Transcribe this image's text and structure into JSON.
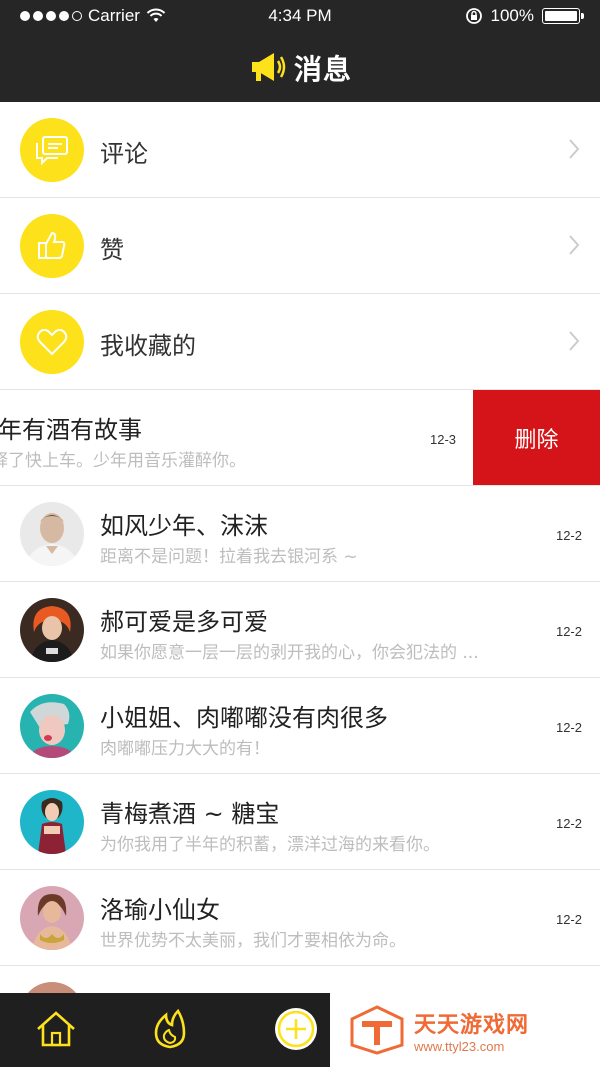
{
  "status_bar": {
    "carrier": "Carrier",
    "time": "4:34 PM",
    "battery": "100%"
  },
  "header": {
    "title": "消息",
    "icon": "megaphone-icon"
  },
  "menu": [
    {
      "label": "评论",
      "icon": "comment-icon"
    },
    {
      "label": "赞",
      "icon": "thumbs-up-icon"
    },
    {
      "label": "我收藏的",
      "icon": "heart-icon"
    }
  ],
  "swiped_message": {
    "name": "少年有酒有故事",
    "preview": "解释了快上车。少年用音乐灌醉你。",
    "date": "12-3",
    "delete_label": "删除"
  },
  "messages": [
    {
      "name": "如风少年、沫沫",
      "preview": "距离不是问题！拉着我去银河系 ~",
      "date": "12-2"
    },
    {
      "name": "郝可爱是多可爱",
      "preview": "如果你愿意一层一层的剥开我的心，你会犯法的 ...",
      "date": "12-2"
    },
    {
      "name": "小姐姐、肉嘟嘟没有肉很多",
      "preview": "肉嘟嘟压力大大的有！",
      "date": "12-2"
    },
    {
      "name": "青梅煮酒 ~ 糖宝",
      "preview": "为你我用了半年的积蓄，漂洋过海的来看你。",
      "date": "12-2"
    },
    {
      "name": "洛瑜小仙女",
      "preview": "世界优势不太美丽，我们才要相依为命。",
      "date": "12-2"
    }
  ],
  "tabbar": {
    "tabs": [
      "home-icon",
      "flame-icon",
      "add-icon"
    ]
  },
  "watermark": {
    "text": "天天游戏网",
    "url": "www.ttyl23.com"
  },
  "colors": {
    "accent_yellow": "#fde21b",
    "header_bg": "#262626",
    "delete_red": "#d5141a"
  }
}
